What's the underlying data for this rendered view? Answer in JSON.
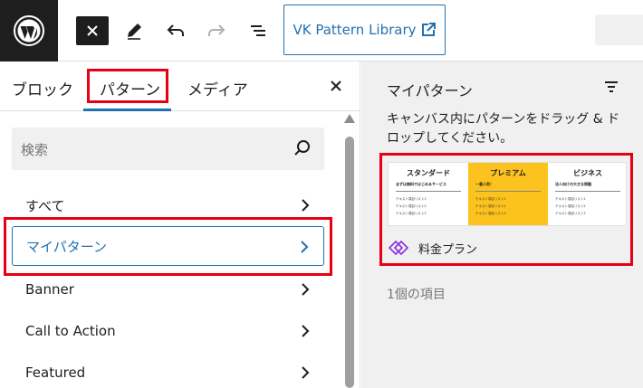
{
  "toolbar": {
    "vk_button_label": "VK Pattern Library"
  },
  "tabs": [
    {
      "label": "ブロック"
    },
    {
      "label": "パターン"
    },
    {
      "label": "メディア"
    }
  ],
  "search": {
    "placeholder": "検索"
  },
  "categories": [
    {
      "label": "すべて"
    },
    {
      "label": "マイパターン"
    },
    {
      "label": "Banner"
    },
    {
      "label": "Call to Action"
    },
    {
      "label": "Featured"
    }
  ],
  "right_panel": {
    "title": "マイパターン",
    "description": "キャンバス内にパターンをドラッグ & ドロップしてください。",
    "pattern": {
      "name": "料金プラン",
      "preview_columns": [
        {
          "title": "スタンダード",
          "subtitle": "まずは無料ではじめるサービス",
          "items": [
            "テキスト項目リスト1",
            "テキスト項目リスト2",
            "テキスト項目リスト3"
          ]
        },
        {
          "title": "プレミアム",
          "subtitle": "一番人気！",
          "items": [
            "テキスト項目リスト1",
            "テキスト項目リスト2",
            "テキスト項目リスト3"
          ]
        },
        {
          "title": "ビジネス",
          "subtitle": "法人向けの大きな問題",
          "items": [
            "テキスト項目リスト1",
            "テキスト項目リスト2",
            "テキスト項目リスト3"
          ]
        }
      ]
    },
    "count_text": "1個の項目"
  },
  "colors": {
    "accent": "#2271b1",
    "highlight": "#e60012",
    "premium": "#fcc21d",
    "pattern_icon": "#8a2be2"
  }
}
